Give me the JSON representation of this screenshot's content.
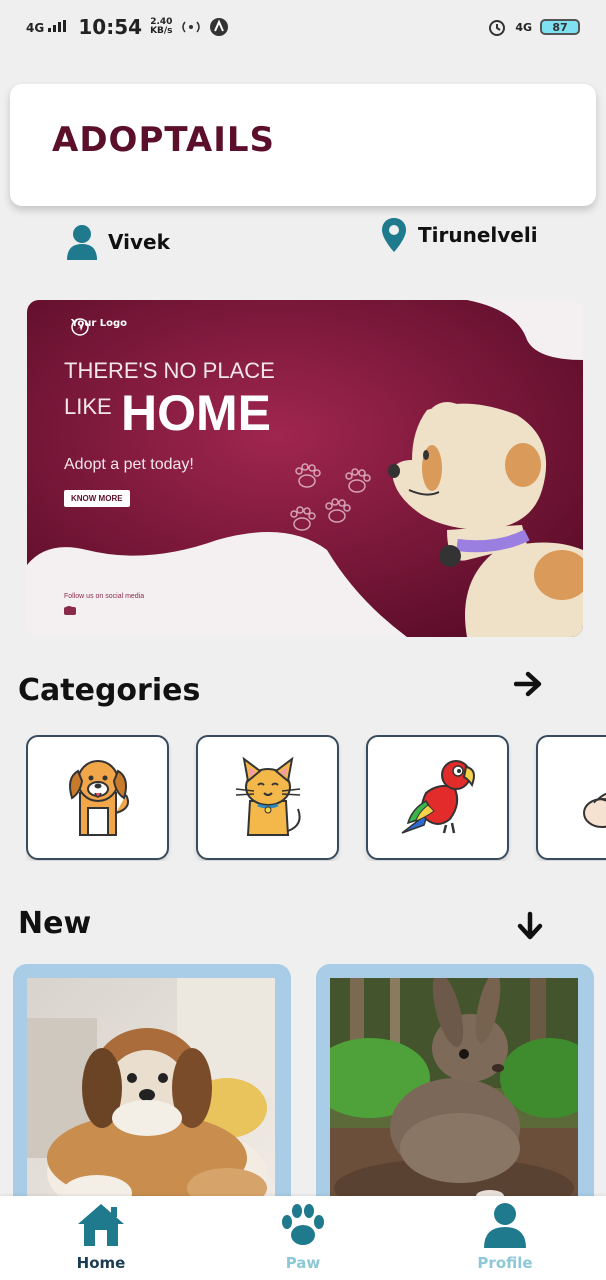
{
  "status_bar": {
    "signal": "4G",
    "time": "10:54",
    "speed_value": "2.40",
    "speed_unit": "KB/s",
    "network_right": "4G",
    "battery": "87"
  },
  "header": {
    "title": "ADOPTAILS"
  },
  "user": {
    "name": "Vivek",
    "icon": "user-icon"
  },
  "location": {
    "city": "Tirunelveli",
    "icon": "location-pin-icon"
  },
  "banner": {
    "logo_text": "Your Logo",
    "line1": "THERE'S NO PLACE",
    "like": "LIKE",
    "home": "HOME",
    "tagline": "Adopt a pet today!",
    "button": "KNOW MORE",
    "follow": "Follow us on social media",
    "social_icons": [
      "twitter-icon",
      "youtube-icon",
      "snapchat-icon"
    ],
    "colors": {
      "primary": "#6e0f33",
      "accent": "#a0264f"
    }
  },
  "categories": {
    "title": "Categories",
    "items": [
      {
        "icon": "dog-icon"
      },
      {
        "icon": "cat-icon"
      },
      {
        "icon": "parrot-icon"
      },
      {
        "icon": "rabbit-icon"
      }
    ]
  },
  "new_section": {
    "title": "New",
    "pets": [
      {
        "photo": "shih-tzu-dog-photo"
      },
      {
        "photo": "rabbit-photo"
      }
    ]
  },
  "bottom_nav": {
    "items": [
      {
        "label": "Home",
        "icon": "home-icon",
        "active": true
      },
      {
        "label": "Paw",
        "icon": "paw-icon",
        "active": false
      },
      {
        "label": "Profile",
        "icon": "profile-icon",
        "active": false
      }
    ]
  },
  "colors": {
    "brand": "#5b0f2a",
    "teal": "#1e7a8c",
    "card_border": "#364b5e",
    "pet_card_bg": "#a9cde6",
    "nav_inactive": "#8cc8d6"
  }
}
